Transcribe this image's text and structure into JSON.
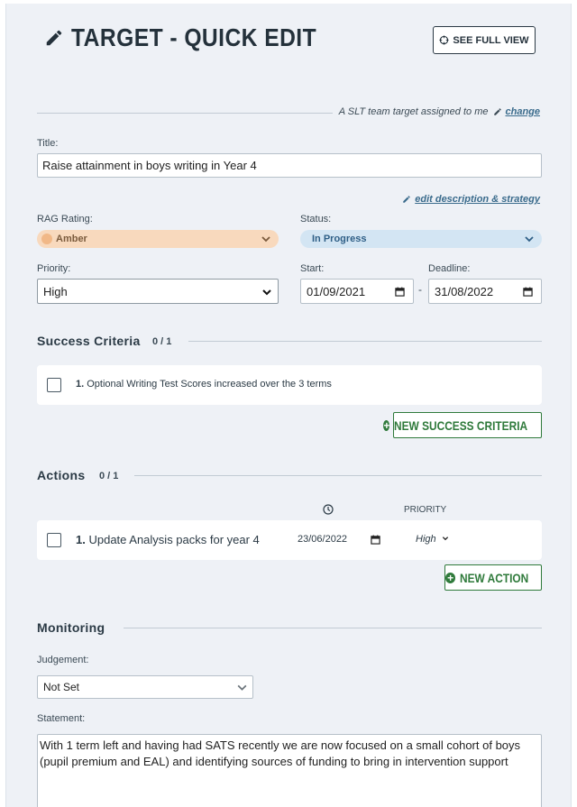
{
  "header": {
    "title": "TARGET - QUICK EDIT",
    "see_full_view": "SEE FULL VIEW"
  },
  "assignment": {
    "text": "A SLT team target assigned to me",
    "change_link": "change"
  },
  "title_field": {
    "label": "Title:",
    "value": "Raise attainment in boys writing in Year 4"
  },
  "edit_description_link": "edit description & strategy",
  "rag": {
    "label": "RAG Rating:",
    "value": "Amber",
    "color": "#f8d9bd",
    "dot_color": "#f1b887"
  },
  "status": {
    "label": "Status:",
    "value": "In Progress",
    "color": "#d3e5f3"
  },
  "priority": {
    "label": "Priority:",
    "value": "High"
  },
  "start": {
    "label": "Start:",
    "value": "01/09/2021"
  },
  "dash": "-",
  "deadline": {
    "label": "Deadline:",
    "value": "31/08/2022"
  },
  "success_criteria": {
    "title": "Success Criteria",
    "count": "0 / 1",
    "items": [
      {
        "num": "1.",
        "text": "Optional Writing Test Scores increased over the 3 terms"
      }
    ],
    "new_button": "NEW SUCCESS CRITERIA"
  },
  "actions": {
    "title": "Actions",
    "count": "0 / 1",
    "priority_header": "PRIORITY",
    "items": [
      {
        "num": "1.",
        "text": "Update Analysis packs for year 4",
        "date": "23/06/2022",
        "priority": "High"
      }
    ],
    "new_button": "NEW ACTION"
  },
  "monitoring": {
    "title": "Monitoring",
    "judgement_label": "Judgement:",
    "judgement_value": "Not Set",
    "statement_label": "Statement:",
    "statement_value": "With 1 term left and having had SATS recently we are now focused on a small cohort of boys (pupil premium and EAL) and identifying sources of funding to bring in intervention support"
  },
  "colors": {
    "accent_green": "#2f7a3b",
    "link_blue": "#3a6b8c",
    "panel_bg": "#eef1f6"
  }
}
